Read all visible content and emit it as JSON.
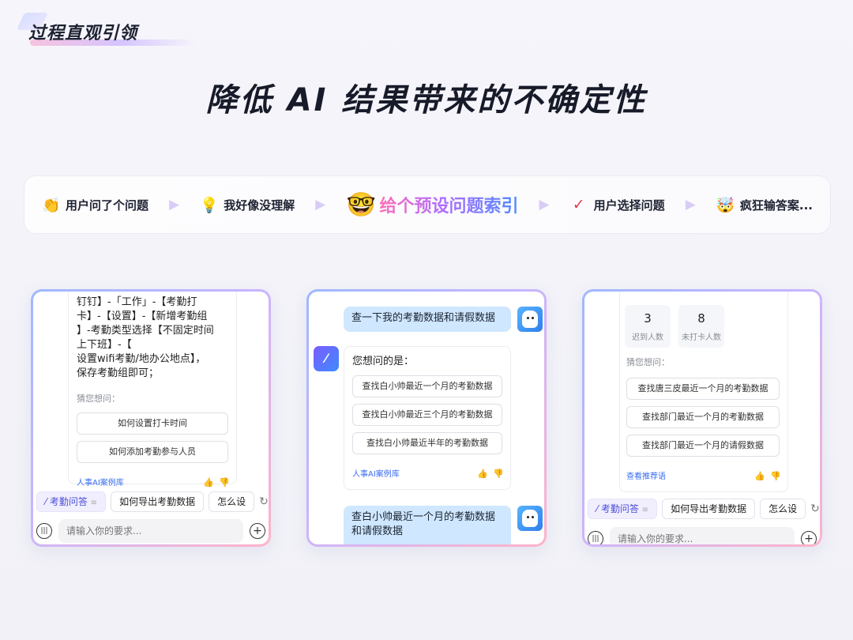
{
  "header": {
    "section_tag": "过程直观引领",
    "headline": "降低 AI 结果带来的不确定性"
  },
  "steps": [
    {
      "icon": "👏",
      "label": "用户问了个问题"
    },
    {
      "icon": "💡",
      "label": "我好像没理解"
    },
    {
      "icon": "🤓",
      "label": "给个预设问题索引"
    },
    {
      "icon": "✓",
      "label": "用户选择问题"
    },
    {
      "icon": "🤯",
      "label": "疯狂输答案..."
    }
  ],
  "card1": {
    "answer_lines": [
      "钉钉】-「工作」-【考勤打",
      "卡】-【设置】-【新增考勤组",
      "】-考勤类型选择【不固定时间",
      "上下班】-【",
      "设置wifi考勤/地办公地点】，",
      "保存考勤组即可；"
    ],
    "guess_label": "猜您想问：",
    "suggestions": [
      "如何设置打卡时间",
      "如何添加考勤参与人员"
    ],
    "footer_link": "人事AI案例库",
    "chips": [
      "考勤问答",
      "如何导出考勤数据",
      "怎么设"
    ],
    "input_placeholder": "请输入你的要求..."
  },
  "card2": {
    "user_query_1": "查一下我的考勤数据和请假数据",
    "ai_intro": "您想问的是：",
    "suggestions": [
      "查找白小帅最近一个月的考勤数据",
      "查找白小帅最近三个月的考勤数据",
      "查找白小帅最近半年的考勤数据"
    ],
    "footer_link": "人事AI案例库",
    "user_query_2": "查白小帅最近一个月的考勤数据和请假数据"
  },
  "card3": {
    "stats": [
      {
        "num": "3",
        "cap": "迟到人数"
      },
      {
        "num": "8",
        "cap": "未打卡人数"
      }
    ],
    "guess_label": "猜您想问：",
    "suggestions": [
      "查找唐三皮最近一个月的考勤数据",
      "查找部门最近一个月的考勤数据",
      "查找部门最近一个月的请假数据"
    ],
    "footer_link": "查看推荐语",
    "chips": [
      "考勤问答",
      "如何导出考勤数据",
      "怎么设"
    ],
    "input_placeholder": "请输入你的要求..."
  }
}
